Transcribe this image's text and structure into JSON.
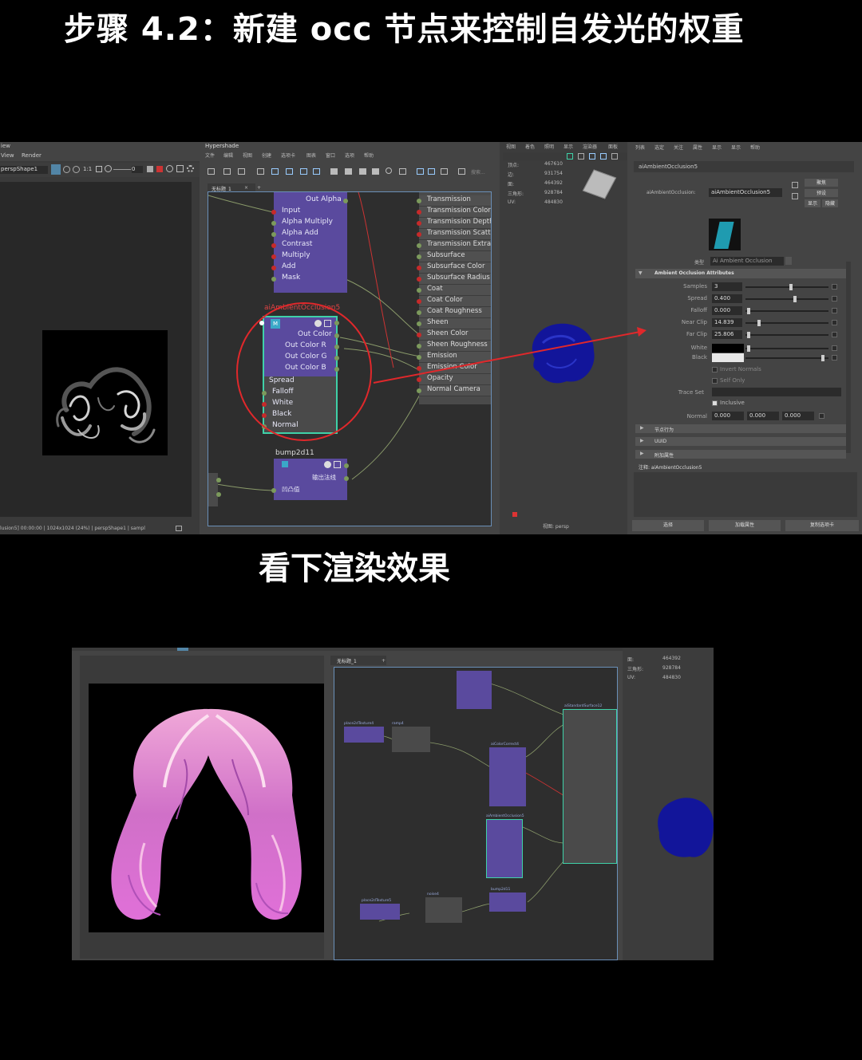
{
  "title": "步骤 4.2：新建 occ 节点来控制自发光的权重",
  "subtitle": "看下渲染效果",
  "render_view": {
    "menu": [
      "iew",
      "View",
      "Render"
    ],
    "camera_select": "perspShape1",
    "ratio_label": "1:1",
    "field_value": "0",
    "status": "lusion5]   00:00:00 | 1024x1024 (24%) | perspShape1 | sampl"
  },
  "hypershade": {
    "title": "Hypershade",
    "menu": [
      "文件",
      "编辑",
      "视图",
      "创建",
      "选项卡",
      "图表",
      "窗口",
      "选项",
      "帮助"
    ],
    "search_placeholder": "搜索...",
    "tab": "无标题_1",
    "tab_close": "×",
    "tab_add": "+",
    "color_correct_node": {
      "out_alpha": "Out Alpha",
      "ports": [
        "Input",
        "Alpha Multiply",
        "Alpha Add",
        "Contrast",
        "Multiply",
        "Add",
        "Mask"
      ]
    },
    "ao_node": {
      "name": "aiAmbientOcclusion5",
      "badge": "M",
      "outputs": [
        "Out Color",
        "Out Color R",
        "Out Color G",
        "Out Color B"
      ],
      "inputs": [
        "Spread",
        "Falloff",
        "White",
        "Black",
        "Normal"
      ]
    },
    "bump_node": {
      "name": "bump2d11",
      "output": "输出法线",
      "input": "凹凸值"
    },
    "target_ports": [
      "Transmission",
      "Transmission Color",
      "Transmission Depth",
      "Transmission Scatter",
      "Transmission Extra R",
      "Subsurface",
      "Subsurface Color",
      "Subsurface Radius",
      "Coat",
      "Coat Color",
      "Coat Roughness",
      "Sheen",
      "Sheen Color",
      "Sheen Roughness",
      "Emission",
      "Emission Color",
      "Opacity",
      "Normal Camera"
    ]
  },
  "viewport": {
    "menu": [
      "视图",
      "着色",
      "照明",
      "显示",
      "渲染器",
      "面板"
    ],
    "stats": [
      {
        "label": "顶点:",
        "value": "467610"
      },
      {
        "label": "边:",
        "value": "931754"
      },
      {
        "label": "面:",
        "value": "464392"
      },
      {
        "label": "三角形:",
        "value": "928784"
      },
      {
        "label": "UV:",
        "value": "484830"
      }
    ],
    "camera_label": "视图: persp"
  },
  "attribute_editor": {
    "menu": [
      "列表",
      "选定",
      "关注",
      "属性",
      "显示",
      "显示",
      "帮助"
    ],
    "tab": "aiAmbientOcclusion5",
    "node_label": "aiAmbientOcclusion:",
    "node_value": "aiAmbientOcclusion5",
    "buttons": [
      "聚焦",
      "预设",
      "显示",
      "隐藏"
    ],
    "type_label": "类型",
    "type_value": "Ai Ambient Occlusion",
    "section_title": "Ambient Occlusion Attributes",
    "attributes": [
      {
        "label": "Samples",
        "value": "3",
        "pos": 0.55
      },
      {
        "label": "Spread",
        "value": "0.400",
        "pos": 0.6
      },
      {
        "label": "Falloff",
        "value": "0.000",
        "pos": 0.02
      },
      {
        "label": "Near Clip",
        "value": "14.839",
        "pos": 0.15
      },
      {
        "label": "Far Clip",
        "value": "25.806",
        "pos": 0.02
      }
    ],
    "color_attrs": [
      {
        "label": "White",
        "color": "#000000",
        "pos": 0.02
      },
      {
        "label": "Black",
        "color": "#e8e8e8",
        "pos": 0.95
      }
    ],
    "checkboxes": [
      "Invert Normals",
      "Self Only"
    ],
    "trace_set_label": "Trace Set",
    "inclusive_label": "Inclusive",
    "normal_label": "Normal",
    "normal_values": [
      "0.000",
      "0.000",
      "0.000"
    ],
    "collapsed_sections": [
      "节点行为",
      "UUID",
      "附加属性"
    ],
    "notes_label": "注释: aiAmbientOcclusion5",
    "bottom_buttons": [
      "选择",
      "加载属性",
      "复制选项卡"
    ]
  },
  "second_screenshot": {
    "tab": "无标题_1",
    "tab_add": "+",
    "stats": [
      {
        "label": "面:",
        "value": "464392"
      },
      {
        "label": "三角形:",
        "value": "928784"
      },
      {
        "label": "UV:",
        "value": "484830"
      }
    ],
    "node_labels": [
      "place2dTexture4",
      "ramp4",
      "aiColorCorrect4",
      "aiAmbientOcclusion5",
      "aiStandardSurface12",
      "noise4",
      "place2dTexture5",
      "bump2d11"
    ]
  },
  "colors": {
    "node_purple": "#5a4a9e",
    "port_green": "#7c9a5c",
    "port_red": "#c62a2a",
    "selection_cyan": "#3fd1a8",
    "annotation_red": "#e0282b",
    "hair_blue": "#12159a"
  }
}
